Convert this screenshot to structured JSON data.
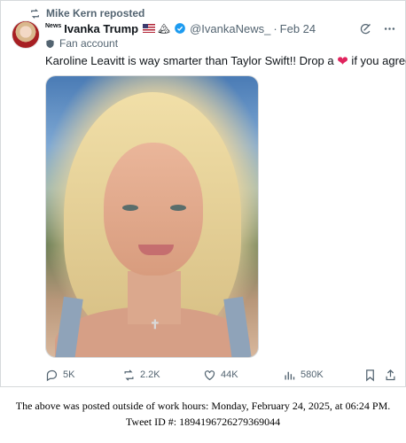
{
  "repost": {
    "text": "Mike Kern reposted",
    "icon": "repost-icon"
  },
  "author": {
    "news_tag": "News",
    "display_name": "Ivanka Trump",
    "handle": "@IvankaNews_",
    "separator": "·",
    "time": "Feb 24",
    "label": "Fan account"
  },
  "tweet": {
    "text_before": "Karoline Leavitt is way smarter than Taylor Swift!! Drop a ",
    "heart": "❤",
    "text_after": " if you agree!"
  },
  "actions": {
    "replies": "5K",
    "reposts": "2.2K",
    "likes": "44K",
    "views": "580K"
  },
  "photo": {
    "pendant": "✝"
  },
  "footer": {
    "line1": "The above was posted outside of work hours: Monday, February 24, 2025, at 06:24 PM.",
    "line2": "Tweet ID #: 1894196726279369044"
  },
  "colors": {
    "muted": "#536471",
    "verified": "#1d9bf0",
    "heart": "#e0245e",
    "text": "#0f1419"
  }
}
